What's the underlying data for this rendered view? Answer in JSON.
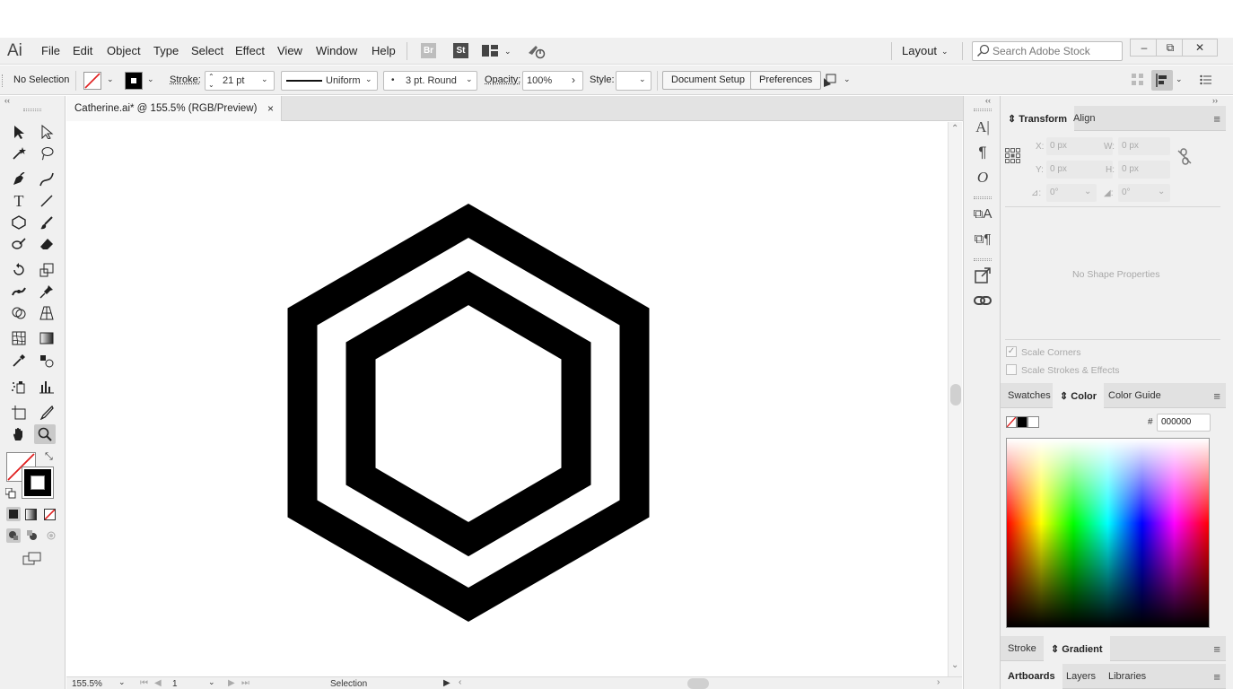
{
  "app": {
    "logo": "Ai",
    "menu": [
      "File",
      "Edit",
      "Object",
      "Type",
      "Select",
      "Effect",
      "View",
      "Window",
      "Help"
    ],
    "bridge_label": "Br",
    "stock_label": "St",
    "workspace": "Layout",
    "search_placeholder": "Search Adobe Stock"
  },
  "control_bar": {
    "selection": "No Selection",
    "stroke_label": "Stroke:",
    "stroke_weight": "21 pt",
    "profile": "Uniform",
    "brush": "3 pt. Round",
    "opacity_label": "Opacity:",
    "opacity_value": "100%",
    "style_label": "Style:",
    "document_setup": "Document Setup",
    "preferences": "Preferences"
  },
  "document": {
    "tab_title": "Catherine.ai* @ 155.5% (RGB/Preview)",
    "close": "×"
  },
  "status_bar": {
    "zoom": "155.5%",
    "artboard": "1",
    "mode": "Selection"
  },
  "transform_panel": {
    "tabs": [
      "Transform",
      "Align"
    ],
    "x_label": "X:",
    "x": "0 px",
    "w_label": "W:",
    "w": "0 px",
    "y_label": "Y:",
    "y": "0 px",
    "h_label": "H:",
    "h": "0 px",
    "angle": "0°",
    "shear": "0°",
    "empty_message": "No Shape Properties",
    "scale_corners": "Scale Corners",
    "scale_strokes": "Scale Strokes & Effects"
  },
  "color_panel": {
    "tabs": [
      "Swatches",
      "Color",
      "Color Guide"
    ],
    "hash": "#",
    "hex": "000000"
  },
  "stroke_panel": {
    "tabs": [
      "Stroke",
      "Gradient"
    ]
  },
  "bottom_panel": {
    "tabs": [
      "Artboards",
      "Layers",
      "Libraries"
    ]
  },
  "colors": {
    "stroke_fill": "#000000",
    "accent_bridge": "#bdbdbd",
    "accent_stock": "#4b4b4b"
  }
}
